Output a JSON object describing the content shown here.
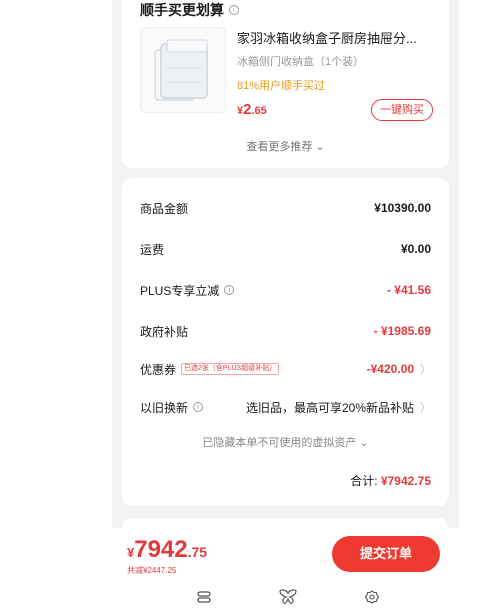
{
  "recommend": {
    "title": "顺手买更划算",
    "info_icon": "info-icon",
    "product_name": "家羽冰箱收纳盒子厨房抽屉分...",
    "product_sub": "冰箱侧门收纳盒（1个装）",
    "badge": "81%用户顺手买过",
    "price_symbol": "¥",
    "price_int": "2",
    "price_dec": ".65",
    "buy_label": "一键购买",
    "more_label": "查看更多推荐 ⌄"
  },
  "summary": {
    "rows": [
      {
        "label": "商品金额",
        "value": "¥10390.00"
      },
      {
        "label": "运费",
        "value": "¥0.00"
      },
      {
        "label": "PLUS专享立减",
        "value": "- ¥41.56"
      },
      {
        "label": "政府补贴",
        "value": "- ¥1985.69"
      },
      {
        "label": "优惠券",
        "tag": "已选2张（含PLUS超级补贴）",
        "value": "-¥420.00"
      },
      {
        "label": "以旧换新",
        "value": "选旧品，最高可享20%新品补贴"
      }
    ],
    "hidden_assets": "已隐藏本单不可使用的虚拟资产 ⌄",
    "total_label": "合计:",
    "total_value": "¥7942.75"
  },
  "bottom": {
    "price_symbol": "¥",
    "price_int": "7942",
    "price_dec": ".75",
    "saved": "共减¥2447.25",
    "submit_label": "提交订单"
  },
  "nav": {
    "icons": [
      "menu-icon",
      "butterfly-icon",
      "settings-icon"
    ]
  },
  "colors": {
    "accent": "#e4393c",
    "submit": "#ef3a32",
    "badge": "#e89a1e",
    "background": "#f2f2f2"
  }
}
